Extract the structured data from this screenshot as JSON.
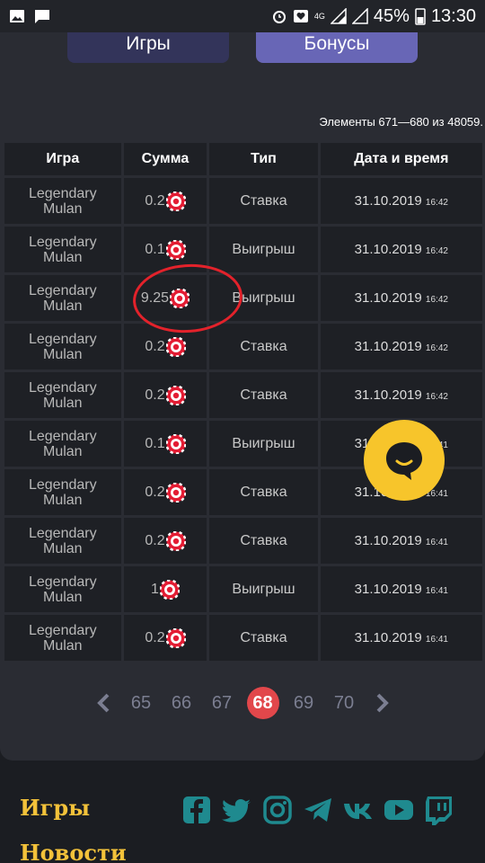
{
  "statusbar": {
    "battery": "45%",
    "time": "13:30",
    "network": "4G"
  },
  "tabs": {
    "games": "Игры",
    "bonuses": "Бонусы"
  },
  "count_label": "Элементы 671—680 из 48059.",
  "table": {
    "headers": [
      "Игра",
      "Сумма",
      "Тип",
      "Дата и время"
    ],
    "rows": [
      {
        "game1": "Legendary",
        "game2": "Mulan",
        "amount": "0.2",
        "type": "Ставка",
        "date": "31.10.2019",
        "time": "16:42"
      },
      {
        "game1": "Legendary",
        "game2": "Mulan",
        "amount": "0.1",
        "type": "Выигрыш",
        "date": "31.10.2019",
        "time": "16:42"
      },
      {
        "game1": "Legendary",
        "game2": "Mulan",
        "amount": "9.25",
        "type": "Выигрыш",
        "date": "31.10.2019",
        "time": "16:42"
      },
      {
        "game1": "Legendary",
        "game2": "Mulan",
        "amount": "0.2",
        "type": "Ставка",
        "date": "31.10.2019",
        "time": "16:42"
      },
      {
        "game1": "Legendary",
        "game2": "Mulan",
        "amount": "0.2",
        "type": "Ставка",
        "date": "31.10.2019",
        "time": "16:42"
      },
      {
        "game1": "Legendary",
        "game2": "Mulan",
        "amount": "0.1",
        "type": "Выигрыш",
        "date": "31.10.2019",
        "time": "16:41"
      },
      {
        "game1": "Legendary",
        "game2": "Mulan",
        "amount": "0.2",
        "type": "Ставка",
        "date": "31.10.2019",
        "time": "16:41"
      },
      {
        "game1": "Legendary",
        "game2": "Mulan",
        "amount": "0.2",
        "type": "Ставка",
        "date": "31.10.2019",
        "time": "16:41"
      },
      {
        "game1": "Legendary",
        "game2": "Mulan",
        "amount": "1",
        "type": "Выигрыш",
        "date": "31.10.2019",
        "time": "16:41"
      },
      {
        "game1": "Legendary",
        "game2": "Mulan",
        "amount": "0.2",
        "type": "Ставка",
        "date": "31.10.2019",
        "time": "16:41"
      }
    ]
  },
  "pager": {
    "pages": [
      "65",
      "66",
      "67",
      "68",
      "69",
      "70"
    ],
    "current": "68"
  },
  "footer": {
    "games_link": "Игры",
    "news_link": "Новости"
  },
  "social_icons": [
    "facebook-icon",
    "twitter-icon",
    "instagram-icon",
    "telegram-icon",
    "vk-icon",
    "youtube-icon",
    "twitch-icon"
  ],
  "colors": {
    "accent": "#6866b6",
    "active_page": "#e2474b",
    "chat": "#f7c52b",
    "footer_link": "#f3c23a",
    "social": "#1f8a8f"
  }
}
